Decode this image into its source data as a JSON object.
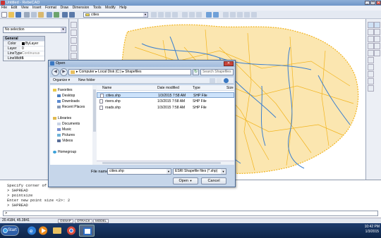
{
  "window": {
    "title": "Untitled - RebeCAD"
  },
  "window_controls": {
    "minimize": "_",
    "maximize": "□",
    "close": "✕"
  },
  "menu": [
    "File",
    "Edit",
    "View",
    "Insert",
    "Format",
    "Draw",
    "Dimension",
    "Tools",
    "Modify",
    "Help"
  ],
  "toolbar": {
    "layer_value": "cities"
  },
  "properties": {
    "selection": "No selection",
    "section": "General",
    "rows": [
      {
        "key": "Color",
        "value": "ByLayer"
      },
      {
        "key": "Layer",
        "value": "0"
      },
      {
        "key": "LineType",
        "value": "Continuous"
      },
      {
        "key": "LineWidth",
        "value": "1"
      }
    ]
  },
  "command": {
    "history": [
      "Specify corner of window",
      "> SHPREAD",
      "> pointsize",
      "Enter new point size <2>: 2",
      "> SHPREAD"
    ],
    "prompt": ">"
  },
  "status": {
    "coords": "20.4184, 45.3841",
    "buttons": [
      "OSNAP",
      "OTRACK",
      "MODEL"
    ]
  },
  "taskbar": {
    "start": "Start",
    "time": "10:42 PM",
    "date": "1/3/2015"
  },
  "dialog": {
    "title": "Open",
    "breadcrumb": "▸ Computer ▸ Local Disk (C:) ▸ Shapefiles",
    "search_placeholder": "Search Shapefiles",
    "organize": "Organize ▾",
    "new_folder": "New folder",
    "nav": [
      {
        "label": "Favorites",
        "kind": "fav"
      },
      {
        "label": "Desktop",
        "kind": "desk"
      },
      {
        "label": "Downloads",
        "kind": "dl"
      },
      {
        "label": "Recent Places",
        "kind": "recent"
      },
      {
        "label": "Libraries",
        "kind": "lib"
      },
      {
        "label": "Documents",
        "kind": "doc"
      },
      {
        "label": "Music",
        "kind": "music"
      },
      {
        "label": "Pictures",
        "kind": "pic"
      },
      {
        "label": "Videos",
        "kind": "vid"
      },
      {
        "label": "Homegroup",
        "kind": "home"
      }
    ],
    "columns": {
      "name": "Name",
      "date": "Date modified",
      "type": "Type",
      "size": "Size"
    },
    "files": [
      {
        "name": "cities.shp",
        "date": "1/3/2015 7:58 AM",
        "type": "SHP File",
        "selected": true
      },
      {
        "name": "rivers.shp",
        "date": "1/3/2015 7:58 AM",
        "type": "SHP File",
        "selected": false
      },
      {
        "name": "roads.shp",
        "date": "1/3/2015 7:58 AM",
        "type": "SHP File",
        "selected": false
      }
    ],
    "filename_label": "File name:",
    "filename": "cities.shp",
    "filetype": "ESRI Shapefile files (*.shp)",
    "open": "Open",
    "cancel": "Cancel"
  },
  "colors": {
    "roads": "#f2b41e",
    "rivers": "#3a7fd0",
    "selection": "#cde3fb"
  }
}
